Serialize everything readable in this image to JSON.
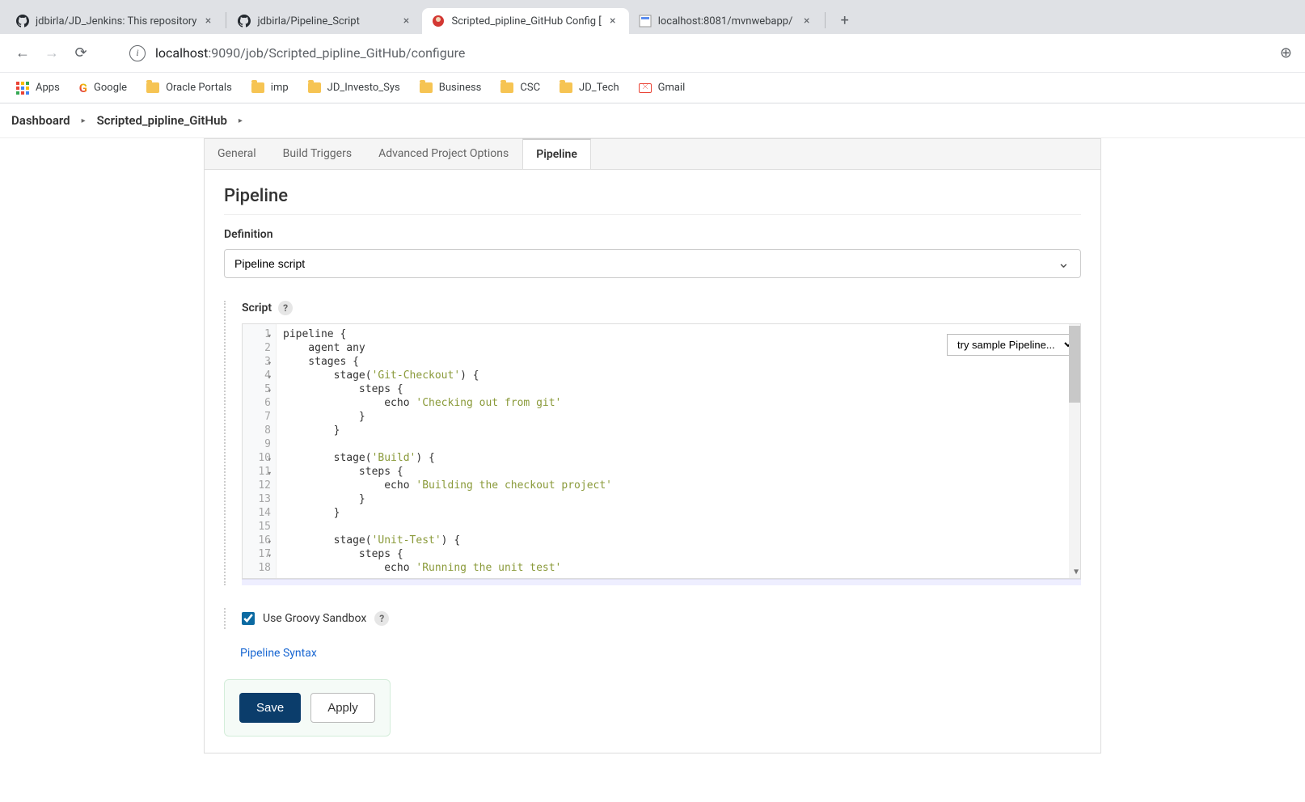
{
  "tabs": [
    {
      "title": "jdbirla/JD_Jenkins: This repository",
      "icon": "github"
    },
    {
      "title": "jdbirla/Pipeline_Script",
      "icon": "github"
    },
    {
      "title": "Scripted_pipline_GitHub Config [",
      "icon": "jenkins",
      "active": true
    },
    {
      "title": "localhost:8081/mvnwebapp/",
      "icon": "app"
    }
  ],
  "address": {
    "host": "localhost",
    "path": ":9090/job/Scripted_pipline_GitHub/configure"
  },
  "bookmarks": {
    "apps": "Apps",
    "google": "Google",
    "oracle": "Oracle Portals",
    "imp": "imp",
    "jdinv": "JD_Investo_Sys",
    "business": "Business",
    "csc": "CSC",
    "jdtech": "JD_Tech",
    "gmail": "Gmail"
  },
  "crumbs": {
    "dashboard": "Dashboard",
    "project": "Scripted_pipline_GitHub"
  },
  "configTabs": {
    "general": "General",
    "triggers": "Build Triggers",
    "advanced": "Advanced Project Options",
    "pipeline": "Pipeline"
  },
  "section": {
    "title": "Pipeline",
    "definitionLabel": "Definition",
    "definitionValue": "Pipeline script",
    "scriptLabel": "Script",
    "sampleLabel": "try sample Pipeline...",
    "sandboxLabel": "Use Groovy Sandbox",
    "syntaxLink": "Pipeline Syntax"
  },
  "code": [
    {
      "n": "1",
      "fold": true,
      "text": "pipeline {",
      "cls": ""
    },
    {
      "n": "2",
      "text": "    agent any",
      "cls": ""
    },
    {
      "n": "3",
      "fold": true,
      "text": "    stages {",
      "cls": ""
    },
    {
      "n": "4",
      "fold": true,
      "text": "        stage('Git-Checkout') {",
      "str": "'Git-Checkout'"
    },
    {
      "n": "5",
      "fold": true,
      "text": "            steps {",
      "cls": ""
    },
    {
      "n": "6",
      "text": "                echo 'Checking out from git'",
      "str": "'Checking out from git'"
    },
    {
      "n": "7",
      "text": "            }",
      "cls": ""
    },
    {
      "n": "8",
      "text": "        }",
      "cls": ""
    },
    {
      "n": "9",
      "text": "",
      "cls": ""
    },
    {
      "n": "10",
      "fold": true,
      "text": "        stage('Build') {",
      "str": "'Build'"
    },
    {
      "n": "11",
      "fold": true,
      "text": "            steps {",
      "cls": ""
    },
    {
      "n": "12",
      "text": "                echo 'Building the checkout project'",
      "str": "'Building the checkout project'"
    },
    {
      "n": "13",
      "text": "            }",
      "cls": ""
    },
    {
      "n": "14",
      "text": "        }",
      "cls": ""
    },
    {
      "n": "15",
      "text": "",
      "cls": ""
    },
    {
      "n": "16",
      "fold": true,
      "text": "        stage('Unit-Test') {",
      "str": "'Unit-Test'"
    },
    {
      "n": "17",
      "fold": true,
      "text": "            steps {",
      "cls": ""
    },
    {
      "n": "18",
      "text": "                echo 'Running the unit test'",
      "str": "'Running the unit test'"
    }
  ],
  "buttons": {
    "save": "Save",
    "apply": "Apply"
  }
}
